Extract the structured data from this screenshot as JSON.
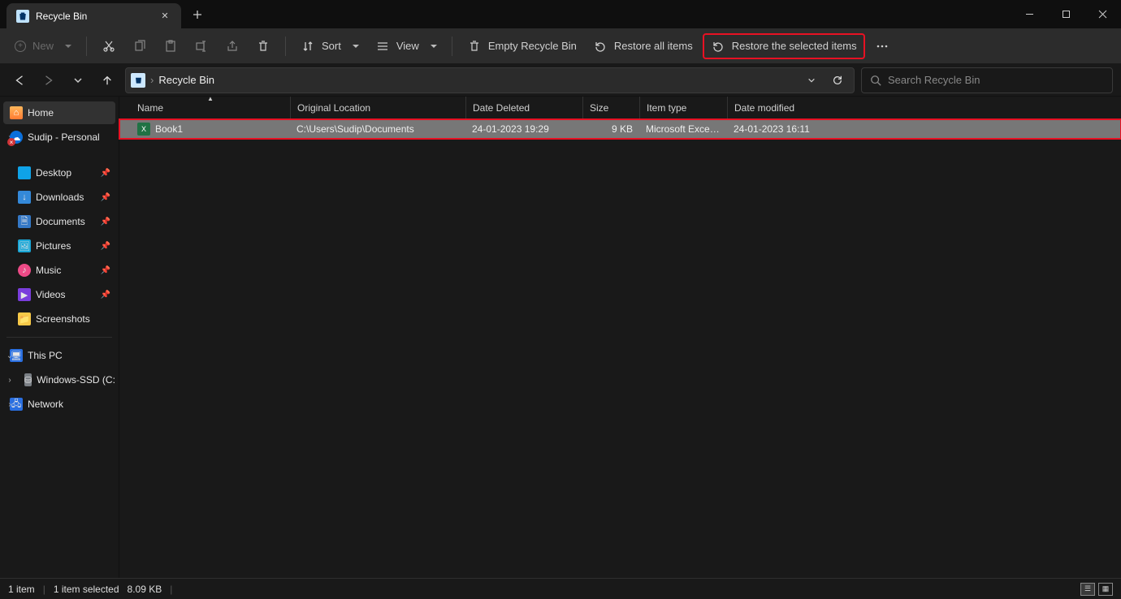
{
  "window": {
    "tab_title": "Recycle Bin"
  },
  "toolbar": {
    "new_label": "New",
    "sort_label": "Sort",
    "view_label": "View",
    "empty_label": "Empty Recycle Bin",
    "restore_all_label": "Restore all items",
    "restore_sel_label": "Restore the selected items"
  },
  "address": {
    "crumb0": "Recycle Bin"
  },
  "search": {
    "placeholder": "Search Recycle Bin"
  },
  "sidebar": {
    "home": "Home",
    "onedrive": "Sudip - Personal",
    "desktop": "Desktop",
    "downloads": "Downloads",
    "documents": "Documents",
    "pictures": "Pictures",
    "music": "Music",
    "videos": "Videos",
    "screenshots": "Screenshots",
    "thispc": "This PC",
    "drive0": "Windows-SSD (C:",
    "network": "Network"
  },
  "columns": {
    "name": "Name",
    "orig": "Original Location",
    "ddel": "Date Deleted",
    "size": "Size",
    "type": "Item type",
    "mod": "Date modified"
  },
  "rows": [
    {
      "name": "Book1",
      "orig": "C:\\Users\\Sudip\\Documents",
      "ddel": "24-01-2023 19:29",
      "size": "9 KB",
      "type": "Microsoft Excel W...",
      "mod": "24-01-2023 16:11"
    }
  ],
  "status": {
    "count": "1 item",
    "selected": "1 item selected",
    "size": "8.09 KB"
  }
}
